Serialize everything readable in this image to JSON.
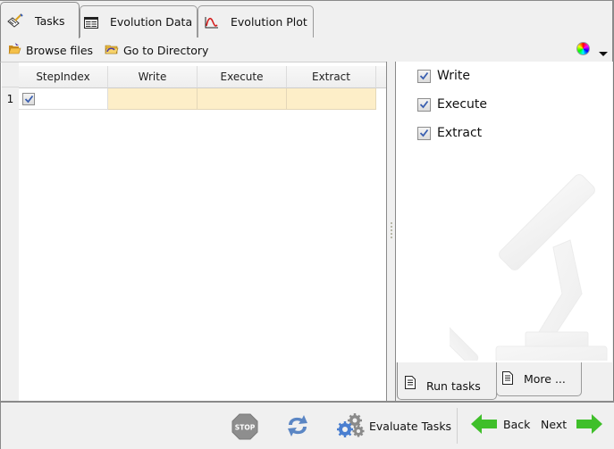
{
  "tabs": [
    {
      "label": "Tasks",
      "icon": "tasks-icon",
      "active": true
    },
    {
      "label": "Evolution Data",
      "icon": "table-icon",
      "active": false
    },
    {
      "label": "Evolution Plot",
      "icon": "plot-icon",
      "active": false
    }
  ],
  "toolbar": {
    "browse_label": "Browse files",
    "goto_label": "Go to Directory"
  },
  "table": {
    "columns": [
      "StepIndex",
      "Write",
      "Execute",
      "Extract"
    ],
    "rows": [
      {
        "row_number": "1",
        "step_checked": true,
        "write": "",
        "execute": "",
        "extract": ""
      }
    ]
  },
  "options": [
    {
      "label": "Write",
      "checked": true
    },
    {
      "label": "Execute",
      "checked": true
    },
    {
      "label": "Extract",
      "checked": true
    }
  ],
  "right_tabs": [
    {
      "label": "Run tasks",
      "active": true
    },
    {
      "label": "More ...",
      "active": false
    }
  ],
  "bottom": {
    "stop_label": "STOP",
    "evaluate_label": "Evaluate Tasks",
    "back_label": "Back",
    "next_label": "Next"
  },
  "colors": {
    "task_cell_bg": "#fdeec8",
    "arrow_green": "#3fbf2a",
    "check_blue": "#3a5fb0",
    "stop_gray": "#8e8e8e",
    "refresh_blue": "#5b86c4"
  }
}
